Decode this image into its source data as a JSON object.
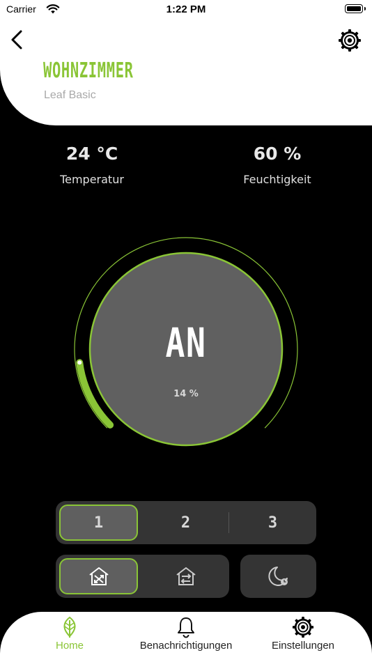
{
  "status_bar": {
    "carrier": "Carrier",
    "time": "1:22 PM"
  },
  "header": {
    "title": "WOHNZIMMER",
    "subtitle": "Leaf Basic"
  },
  "stats": {
    "temperature": {
      "value": "24 °C",
      "label": "Temperatur"
    },
    "humidity": {
      "value": "60 %",
      "label": "Feuchtigkeit"
    }
  },
  "dial": {
    "state": "AN",
    "level_text": "14 %",
    "level_fraction": 0.14
  },
  "speed": {
    "options": [
      "1",
      "2",
      "3"
    ],
    "selected": "1"
  },
  "modes": {
    "selected": "crossflow"
  },
  "tabs": [
    {
      "label": "Home",
      "icon": "leaf-icon",
      "active": true
    },
    {
      "label": "Benachrichtigungen",
      "icon": "bell-icon",
      "active": false
    },
    {
      "label": "Einstellungen",
      "icon": "gear-icon",
      "active": false
    }
  ],
  "colors": {
    "accent": "#8ac536",
    "panel": "#343434",
    "active_panel": "#5f5f5f",
    "dial_fill": "#606060"
  }
}
